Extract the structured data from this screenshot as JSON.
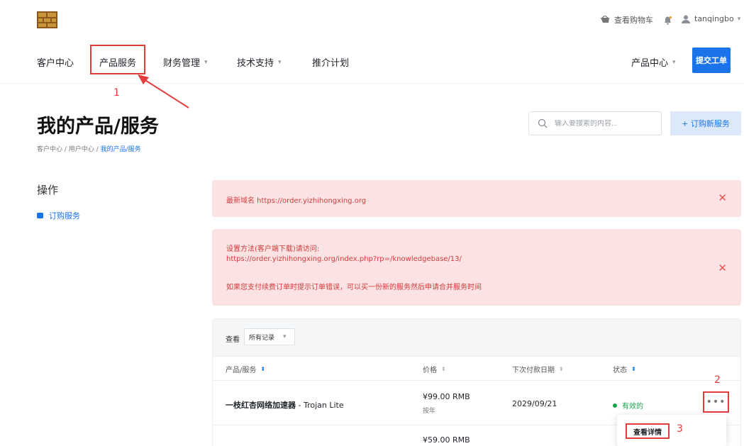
{
  "header": {
    "cart_label": "查看购物车",
    "username": "tanqingbo"
  },
  "nav": {
    "items": [
      {
        "label": "客户中心"
      },
      {
        "label": "产品服务"
      },
      {
        "label": "财务管理"
      },
      {
        "label": "技术支持"
      },
      {
        "label": "推介计划"
      }
    ],
    "product_center": "产品中心",
    "submit_ticket": "提交工单"
  },
  "annotations": [
    "1",
    "2",
    "3"
  ],
  "page": {
    "title": "我的产品/服务",
    "breadcrumb": [
      "客户中心",
      "用户中心",
      "我的产品/服务"
    ],
    "search_placeholder": "输入要搜索的内容...",
    "order_new": "+ 订购新服务"
  },
  "sidebar": {
    "heading": "操作",
    "link": "订购服务"
  },
  "alerts": [
    {
      "line1": "最新域名 https://order.yizhihongxing.org"
    },
    {
      "line1": "设置方法(客户端下载)请访问:",
      "line2": "https://order.yizhihongxing.org/index.php?rp=/knowledgebase/13/",
      "line3": "如果您支付续费订单时提示订单错误，可以买一份新的服务然后申请合并服务时间"
    }
  ],
  "table": {
    "filter_label": "查看",
    "filter_value": "所有记录",
    "columns": [
      "产品/服务",
      "价格",
      "下次付款日期",
      "状态"
    ],
    "rows": [
      {
        "product": "一枝红杏网络加速器",
        "product_suffix": " - Trojan Lite",
        "price": "¥99.00 RMB",
        "cycle": "按年",
        "next_due": "2029/09/21",
        "status": "有效的"
      }
    ],
    "partial_next_price": "¥59.00 RMB",
    "more_glyph": "•••",
    "menu_item": "查看详情"
  }
}
